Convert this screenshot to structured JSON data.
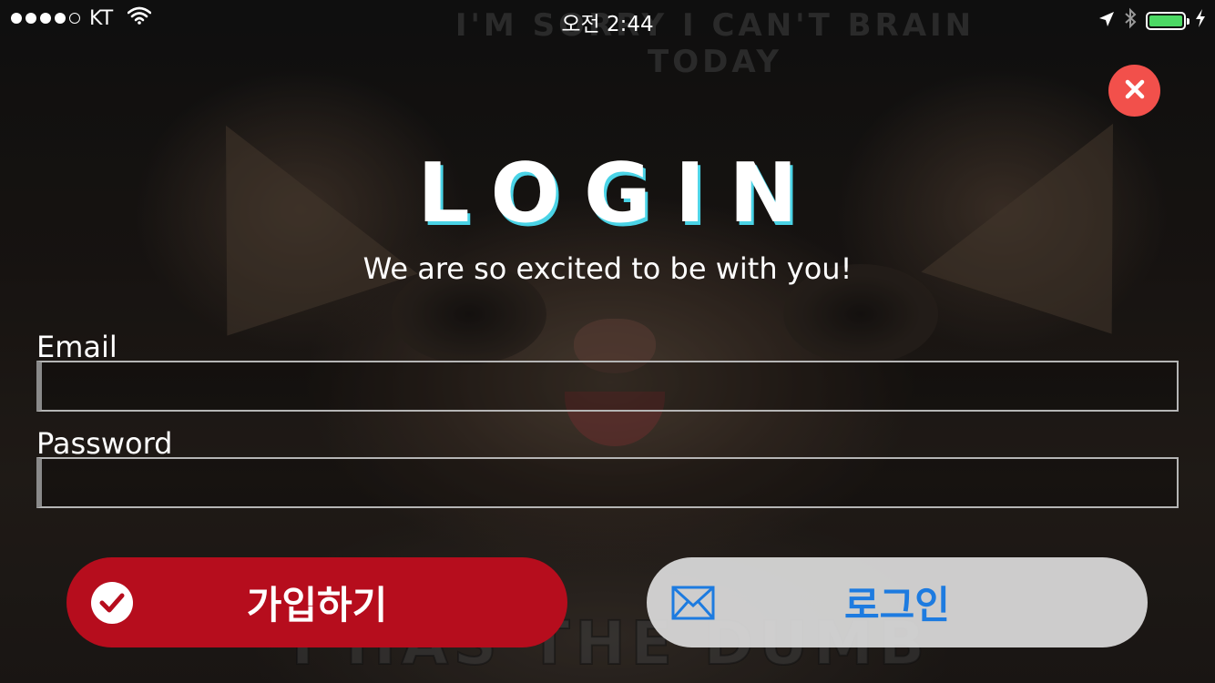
{
  "status_bar": {
    "carrier": "KT",
    "signal_bars_filled": 4,
    "signal_bars_total": 5,
    "time": "오전 2:44",
    "battery_level": 1.0,
    "icons": [
      "wifi-icon",
      "location-arrow-icon",
      "bluetooth-icon",
      "battery-icon",
      "charging-bolt-icon"
    ]
  },
  "background": {
    "top_caption_line1": "I'M SORRY I CAN'T BRAIN",
    "top_caption_line2": "TODAY",
    "bottom_caption": "I HAS THE DUMB"
  },
  "close_button": {
    "icon": "close-icon",
    "color": "#f2504b"
  },
  "header": {
    "title": "LOGIN",
    "subtitle": "We are so excited to be with you!"
  },
  "form": {
    "email_label": "Email",
    "email_value": "",
    "password_label": "Password",
    "password_value": ""
  },
  "actions": {
    "signup_label": "가입하기",
    "signup_icon": "checkmark-circle-icon",
    "signup_color": "#b60d1d",
    "login_label": "로그인",
    "login_icon": "envelope-icon",
    "login_text_color": "#1d7be0"
  }
}
